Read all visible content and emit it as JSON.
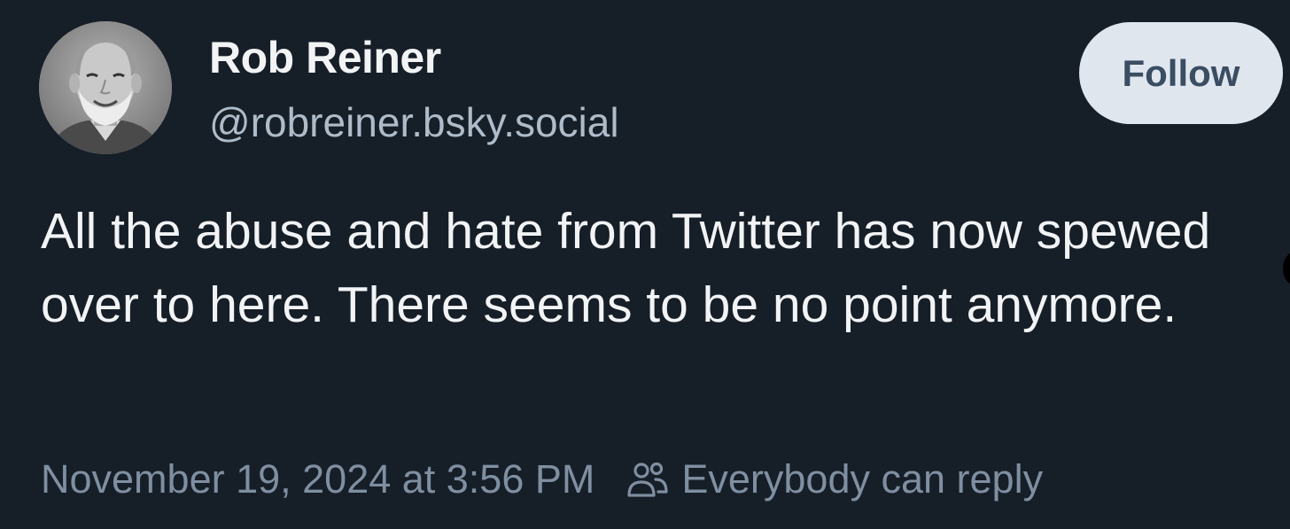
{
  "author": {
    "display_name": "Rob Reiner",
    "handle": "@robreiner.bsky.social"
  },
  "follow_button": {
    "label": "Follow"
  },
  "post": {
    "text": "All the abuse and hate from Twitter has now spewed over to here. There seems to be no point anymore."
  },
  "footer": {
    "timestamp": "November 19, 2024 at 3:56 PM",
    "reply_setting": "Everybody can reply",
    "reply_icon": "people-icon"
  },
  "colors": {
    "background": "#161e27",
    "primary_text": "#f1f3f5",
    "handle_text": "#aebbc9",
    "muted_text": "#7f8fa1",
    "button_bg": "#e0e6ee",
    "button_text": "#3a4d62"
  }
}
